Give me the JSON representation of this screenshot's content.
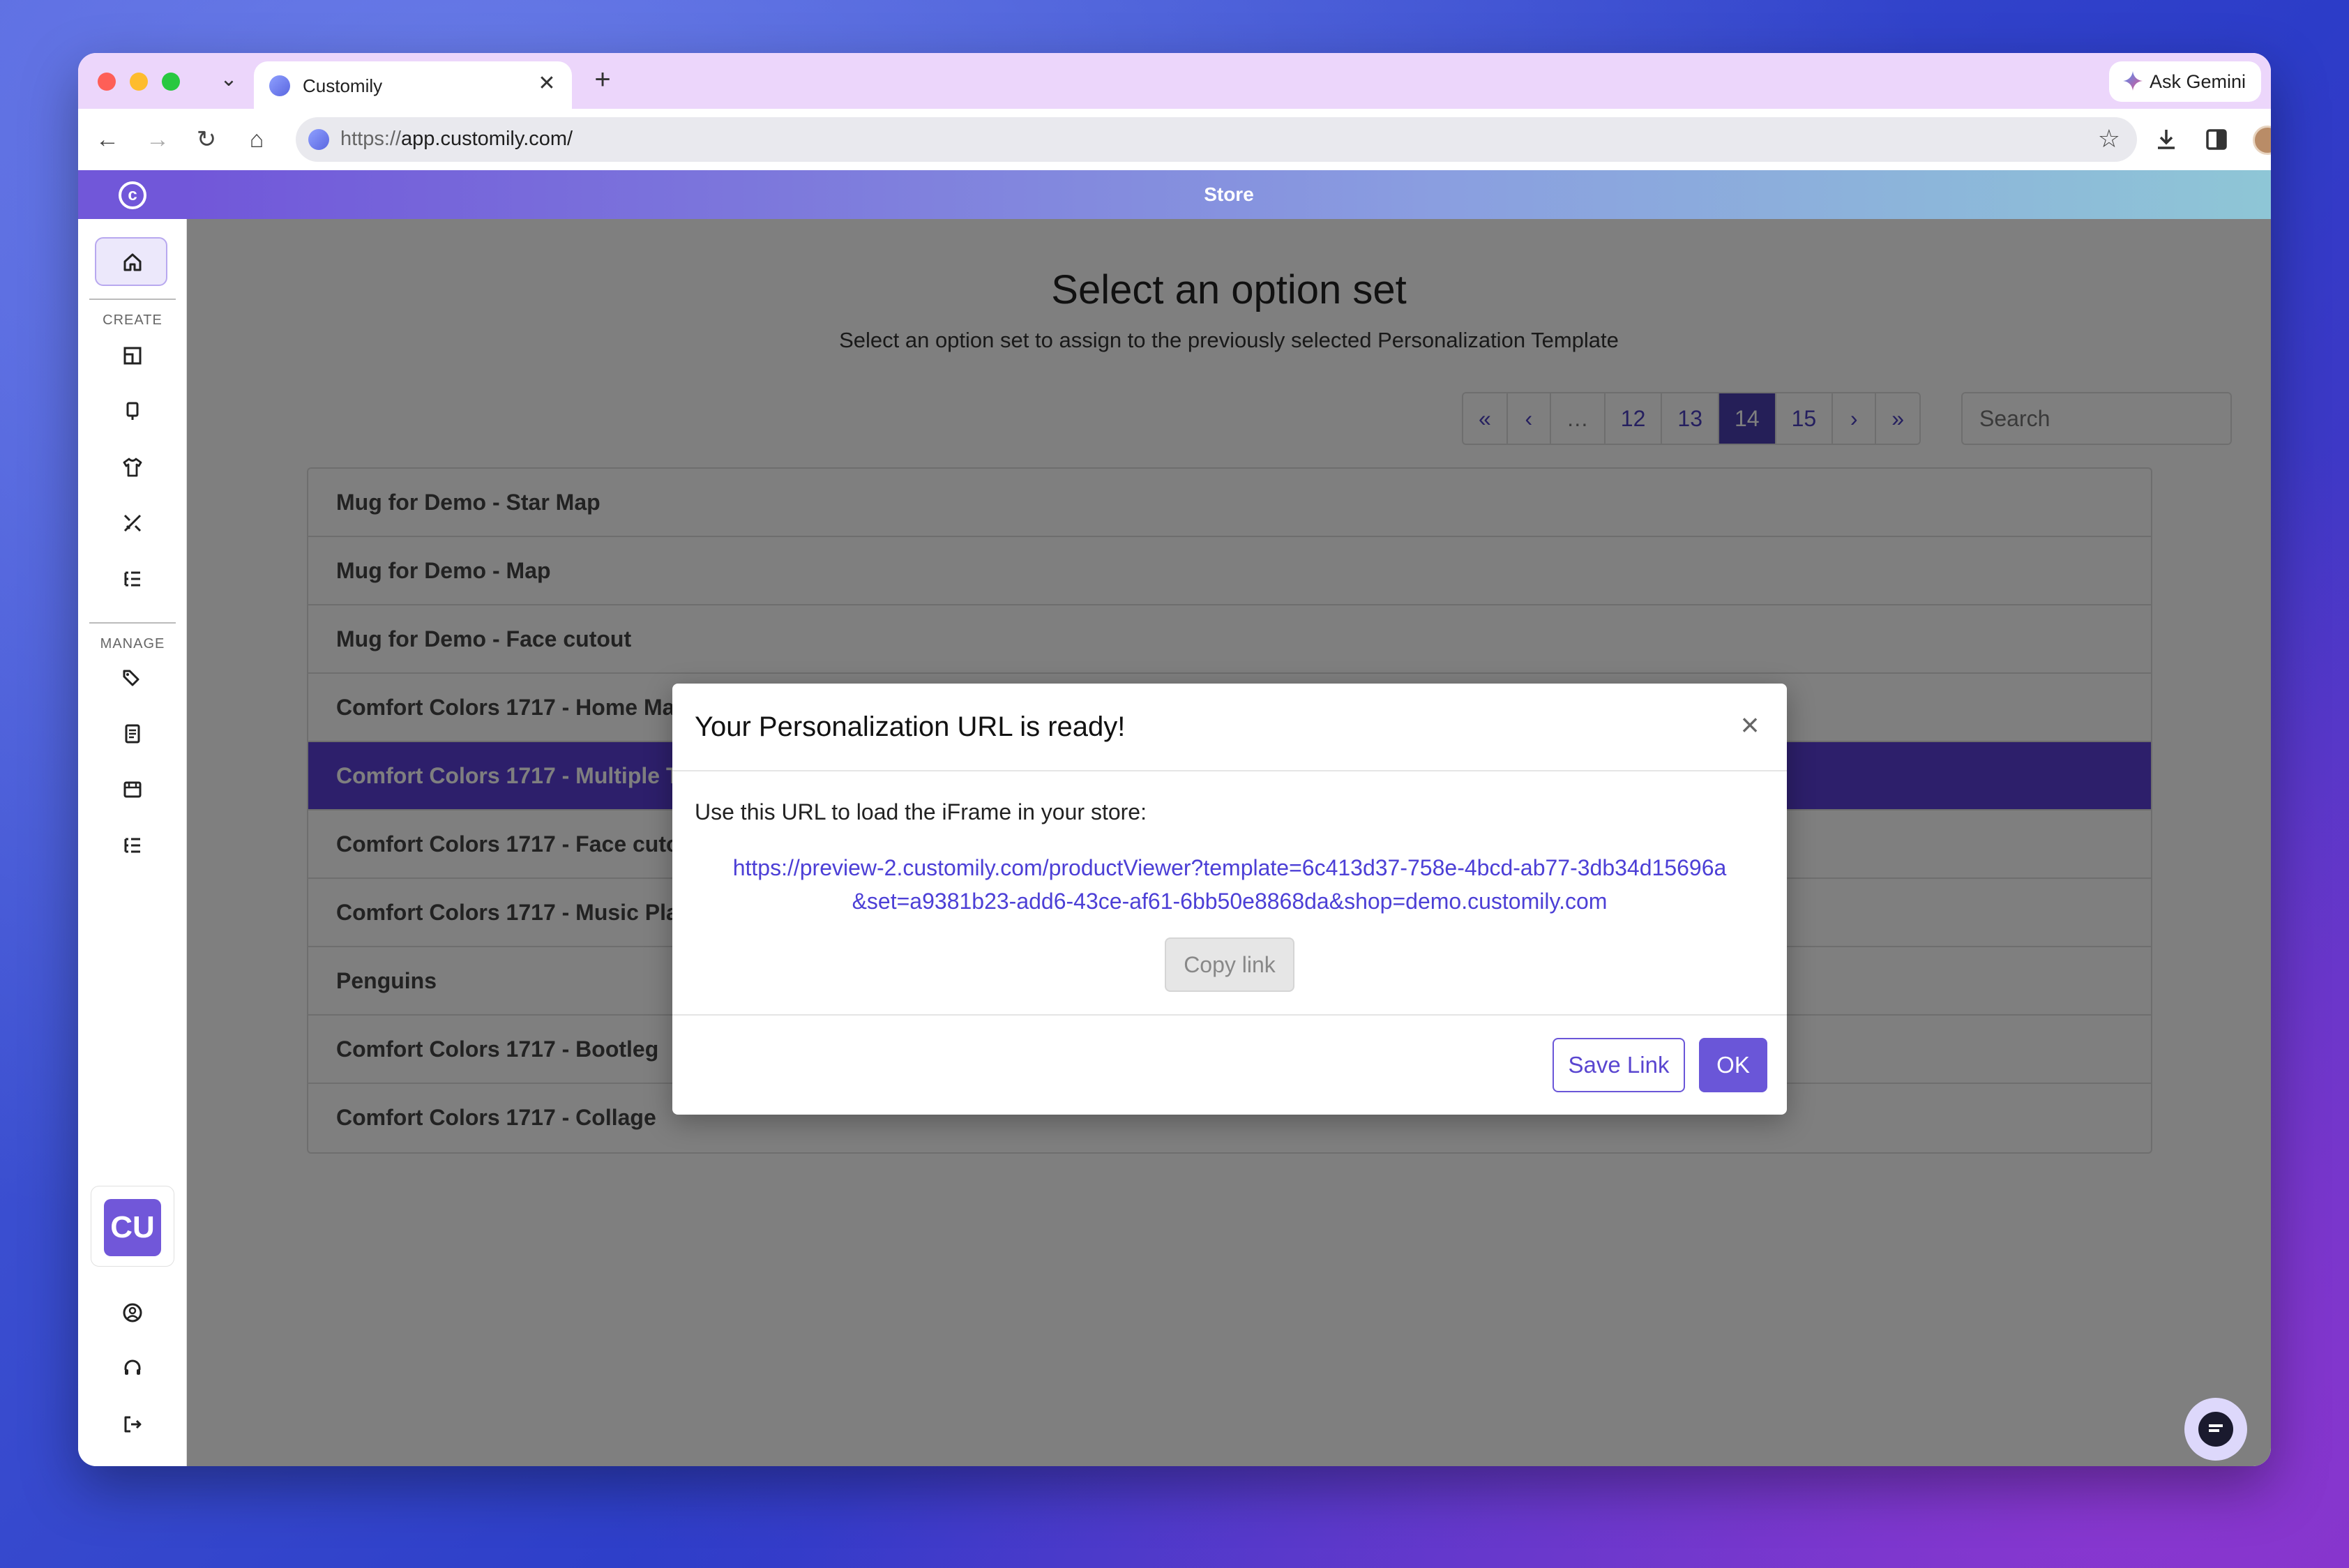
{
  "browser": {
    "tab_title": "Customily",
    "url_scheme": "https://",
    "url_host": "app.customily.com/",
    "gemini_label": "Ask Gemini"
  },
  "app": {
    "header_title": "Store",
    "sidebar": {
      "create_label": "CREATE",
      "manage_label": "MANAGE",
      "user_initials": "CU"
    }
  },
  "page": {
    "title": "Select an option set",
    "subtitle": "Select an option set to assign to the previously selected Personalization Template",
    "pagination": [
      "«",
      "‹",
      "…",
      "12",
      "13",
      "14",
      "15",
      "›",
      "»"
    ],
    "current_page": "14",
    "search_placeholder": "Search",
    "items": [
      "Mug for Demo - Star Map",
      "Mug for Demo - Map",
      "Mug for Demo - Face cutout",
      "Comfort Colors 1717 - Home Ma",
      "Comfort Colors 1717 - Multiple T",
      "Comfort Colors 1717 - Face cuto",
      "Comfort Colors 1717 - Music Pla",
      "Penguins",
      "Comfort Colors 1717 - Bootleg",
      "Comfort Colors 1717 - Collage"
    ],
    "selected_index": 4
  },
  "modal": {
    "title": "Your Personalization URL is ready!",
    "close_label": "×",
    "message": "Use this URL to load the iFrame in your store:",
    "url": "https://preview-2.customily.com/productViewer?template=6c413d37-758e-4bcd-ab77-3db34d15696a&set=a9381b23-add6-43ce-af61-6bb50e8868da&shop=demo.customily.com",
    "copy_label": "Copy link",
    "save_label": "Save Link",
    "ok_label": "OK"
  },
  "colors": {
    "accent": "#6a56d8",
    "selected_row": "#5a3fd6",
    "link": "#4c3fd6"
  }
}
